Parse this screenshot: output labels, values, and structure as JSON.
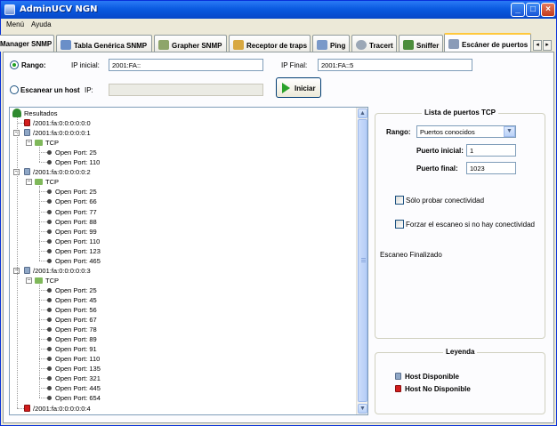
{
  "window": {
    "title": "AdminUCV NGN",
    "buttons": {
      "minimize": "_",
      "maximize": "□",
      "close": "×"
    }
  },
  "menu": [
    "Menú",
    "Ayuda"
  ],
  "tabs": [
    {
      "label": "Manager SNMP",
      "active": false
    },
    {
      "label": "Tabla Genérica SNMP",
      "active": false
    },
    {
      "label": "Grapher SNMP",
      "active": false
    },
    {
      "label": "Receptor de traps",
      "active": false
    },
    {
      "label": "Ping",
      "active": false
    },
    {
      "label": "Tracert",
      "active": false
    },
    {
      "label": "Sniffer",
      "active": false
    },
    {
      "label": "Escáner de puertos",
      "active": true
    }
  ],
  "scan_options": {
    "range_label": "Rango:",
    "ip_start_label": "IP inicial:",
    "ip_start_value": "2001:FA::",
    "ip_end_label": "IP Final:",
    "ip_end_value": "2001:FA::5",
    "single_host_label": "Escanear un host",
    "ip_label": "IP:",
    "ip_value": "",
    "start_button": "Iniciar"
  },
  "tree": {
    "root": "Resultados",
    "hosts": [
      {
        "address": "/2001:fa:0:0:0:0:0:0",
        "available": false,
        "expanded": false,
        "protocol": "",
        "ports": []
      },
      {
        "address": "/2001:fa:0:0:0:0:0:1",
        "available": true,
        "expanded": true,
        "protocol": "TCP",
        "ports": [
          "Open Port: 25",
          "Open Port: 110"
        ]
      },
      {
        "address": "/2001:fa:0:0:0:0:0:2",
        "available": true,
        "expanded": true,
        "protocol": "TCP",
        "ports": [
          "Open Port: 25",
          "Open Port: 66",
          "Open Port: 77",
          "Open Port: 88",
          "Open Port: 99",
          "Open Port: 110",
          "Open Port: 123",
          "Open Port: 465"
        ]
      },
      {
        "address": "/2001:fa:0:0:0:0:0:3",
        "available": true,
        "expanded": true,
        "protocol": "TCP",
        "ports": [
          "Open Port: 25",
          "Open Port: 45",
          "Open Port: 56",
          "Open Port: 67",
          "Open Port: 78",
          "Open Port: 89",
          "Open Port: 91",
          "Open Port: 110",
          "Open Port: 135",
          "Open Port: 321",
          "Open Port: 445",
          "Open Port: 654"
        ]
      },
      {
        "address": "/2001:fa:0:0:0:0:0:4",
        "available": false,
        "expanded": false,
        "protocol": "",
        "ports": []
      }
    ]
  },
  "tcp_panel": {
    "title": "Lista de puertos TCP",
    "range_label": "Rango:",
    "range_value": "Puertos conocidos",
    "port_start_label": "Puerto inicial:",
    "port_start_value": "1",
    "port_end_label": "Puerto final:",
    "port_end_value": "1023",
    "check_connectivity": "Sólo probar conectividad",
    "force_scan": "Forzar el escaneo si no hay conectividad",
    "status": "Escaneo Finalizado"
  },
  "legend": {
    "title": "Leyenda",
    "available": "Host Disponible",
    "unavailable": "Host No Disponible",
    "colors": {
      "available": "#8fa7c6",
      "unavailable": "#d21d1d"
    }
  }
}
